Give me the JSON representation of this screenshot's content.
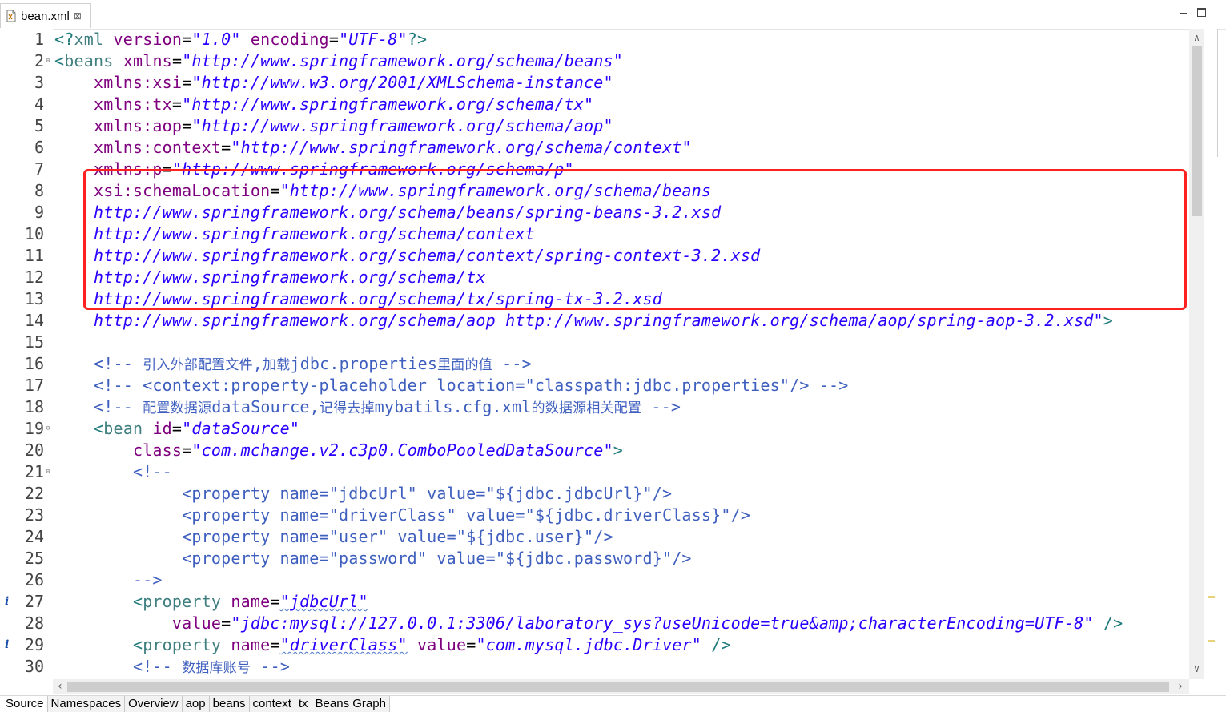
{
  "tab": {
    "label": "bean.xml",
    "close": "⊠"
  },
  "window_controls": {
    "minimize_icon": "minimize-icon",
    "maximize_icon": "maximize-icon"
  },
  "lines": [
    {
      "num": "1",
      "tokens": [
        {
          "c": "tag",
          "t": "<?"
        },
        {
          "c": "el",
          "t": "xml"
        },
        {
          "c": "plain",
          "t": " "
        },
        {
          "c": "attr",
          "t": "version"
        },
        {
          "c": "plain",
          "t": "="
        },
        {
          "c": "val",
          "t": "\"1.0\""
        },
        {
          "c": "plain",
          "t": " "
        },
        {
          "c": "attr",
          "t": "encoding"
        },
        {
          "c": "plain",
          "t": "="
        },
        {
          "c": "val",
          "t": "\"UTF-8\""
        },
        {
          "c": "tag",
          "t": "?>"
        }
      ]
    },
    {
      "num": "2",
      "fold": "⊖",
      "tokens": [
        {
          "c": "tag",
          "t": "<"
        },
        {
          "c": "el",
          "t": "beans"
        },
        {
          "c": "plain",
          "t": " "
        },
        {
          "c": "attr",
          "t": "xmlns"
        },
        {
          "c": "plain",
          "t": "="
        },
        {
          "c": "val",
          "t": "\"http://www.springframework.org/schema/beans\""
        }
      ]
    },
    {
      "num": "3",
      "tokens": [
        {
          "c": "plain",
          "t": "    "
        },
        {
          "c": "attr",
          "t": "xmlns:xsi"
        },
        {
          "c": "plain",
          "t": "="
        },
        {
          "c": "val",
          "t": "\"http://www.w3.org/2001/XMLSchema-instance\""
        }
      ]
    },
    {
      "num": "4",
      "tokens": [
        {
          "c": "plain",
          "t": "    "
        },
        {
          "c": "attr",
          "t": "xmlns:tx"
        },
        {
          "c": "plain",
          "t": "="
        },
        {
          "c": "val",
          "t": "\"http://www.springframework.org/schema/tx\""
        }
      ]
    },
    {
      "num": "5",
      "tokens": [
        {
          "c": "plain",
          "t": "    "
        },
        {
          "c": "attr",
          "t": "xmlns:aop"
        },
        {
          "c": "plain",
          "t": "="
        },
        {
          "c": "val",
          "t": "\"http://www.springframework.org/schema/aop\""
        }
      ]
    },
    {
      "num": "6",
      "tokens": [
        {
          "c": "plain",
          "t": "    "
        },
        {
          "c": "attr",
          "t": "xmlns:context"
        },
        {
          "c": "plain",
          "t": "="
        },
        {
          "c": "val",
          "t": "\"http://www.springframework.org/schema/context\""
        }
      ]
    },
    {
      "num": "7",
      "tokens": [
        {
          "c": "plain",
          "t": "    "
        },
        {
          "c": "attr",
          "t": "xmlns:p"
        },
        {
          "c": "plain",
          "t": "="
        },
        {
          "c": "val",
          "t": "\"http://www.springframework.org/schema/p\""
        }
      ]
    },
    {
      "num": "8",
      "tokens": [
        {
          "c": "plain",
          "t": "    "
        },
        {
          "c": "attr",
          "t": "xsi:schemaLocation"
        },
        {
          "c": "plain",
          "t": "="
        },
        {
          "c": "val",
          "t": "\"http://www.springframework.org/schema/beans"
        }
      ]
    },
    {
      "num": "9",
      "tokens": [
        {
          "c": "plain",
          "t": "    "
        },
        {
          "c": "val",
          "t": "http://www.springframework.org/schema/beans/spring-beans-3.2.xsd"
        }
      ]
    },
    {
      "num": "10",
      "tokens": [
        {
          "c": "plain",
          "t": "    "
        },
        {
          "c": "val",
          "t": "http://www.springframework.org/schema/context"
        }
      ]
    },
    {
      "num": "11",
      "tokens": [
        {
          "c": "plain",
          "t": "    "
        },
        {
          "c": "val",
          "t": "http://www.springframework.org/schema/context/spring-context-3.2.xsd"
        }
      ]
    },
    {
      "num": "12",
      "tokens": [
        {
          "c": "plain",
          "t": "    "
        },
        {
          "c": "val",
          "t": "http://www.springframework.org/schema/tx"
        }
      ]
    },
    {
      "num": "13",
      "tokens": [
        {
          "c": "plain",
          "t": "    "
        },
        {
          "c": "val",
          "t": "http://www.springframework.org/schema/tx/spring-tx-3.2.xsd"
        }
      ]
    },
    {
      "num": "14",
      "tokens": [
        {
          "c": "plain",
          "t": "    "
        },
        {
          "c": "val",
          "t": "http://www.springframework.org/schema/aop http://www.springframework.org/schema/aop/spring-aop-3.2.xsd\""
        },
        {
          "c": "tag",
          "t": ">"
        }
      ]
    },
    {
      "num": "15",
      "tokens": []
    },
    {
      "num": "16",
      "tokens": [
        {
          "c": "plain",
          "t": "    "
        },
        {
          "c": "comment",
          "t": "<!-- "
        },
        {
          "c": "comment-cjk",
          "t": "引入外部配置文件"
        },
        {
          "c": "comment",
          "t": ","
        },
        {
          "c": "comment-cjk",
          "t": "加载"
        },
        {
          "c": "comment",
          "t": "jdbc.properties"
        },
        {
          "c": "comment-cjk",
          "t": "里面的值"
        },
        {
          "c": "comment",
          "t": " -->"
        }
      ]
    },
    {
      "num": "17",
      "tokens": [
        {
          "c": "plain",
          "t": "    "
        },
        {
          "c": "comment",
          "t": "<!-- <context:property-placeholder location=\"classpath:jdbc.properties\"/> -->"
        }
      ]
    },
    {
      "num": "18",
      "tokens": [
        {
          "c": "plain",
          "t": "    "
        },
        {
          "c": "comment",
          "t": "<!-- "
        },
        {
          "c": "comment-cjk",
          "t": "配置数据源"
        },
        {
          "c": "comment",
          "t": "dataSource,"
        },
        {
          "c": "comment-cjk",
          "t": "记得去掉"
        },
        {
          "c": "comment",
          "t": "mybatils.cfg.xml"
        },
        {
          "c": "comment-cjk",
          "t": "的数据源相关配置"
        },
        {
          "c": "comment",
          "t": " -->"
        }
      ]
    },
    {
      "num": "19",
      "fold": "⊖",
      "tokens": [
        {
          "c": "plain",
          "t": "    "
        },
        {
          "c": "tag",
          "t": "<"
        },
        {
          "c": "el",
          "t": "bean"
        },
        {
          "c": "plain",
          "t": " "
        },
        {
          "c": "attr",
          "t": "id"
        },
        {
          "c": "plain",
          "t": "="
        },
        {
          "c": "val",
          "t": "\"dataSource\""
        }
      ]
    },
    {
      "num": "20",
      "tokens": [
        {
          "c": "plain",
          "t": "        "
        },
        {
          "c": "attr",
          "t": "class"
        },
        {
          "c": "plain",
          "t": "="
        },
        {
          "c": "val",
          "t": "\"com.mchange.v2.c3p0.ComboPooledDataSource\""
        },
        {
          "c": "tag",
          "t": ">"
        }
      ]
    },
    {
      "num": "21",
      "fold": "⊖",
      "tokens": [
        {
          "c": "plain",
          "t": "        "
        },
        {
          "c": "comment",
          "t": "<!--"
        }
      ]
    },
    {
      "num": "22",
      "tokens": [
        {
          "c": "plain",
          "t": "             "
        },
        {
          "c": "comment",
          "t": "<property name=\"jdbcUrl\" value=\"${jdbc.jdbcUrl}\"/>"
        }
      ]
    },
    {
      "num": "23",
      "tokens": [
        {
          "c": "plain",
          "t": "             "
        },
        {
          "c": "comment",
          "t": "<property name=\"driverClass\" value=\"${jdbc.driverClass}\"/>"
        }
      ]
    },
    {
      "num": "24",
      "tokens": [
        {
          "c": "plain",
          "t": "             "
        },
        {
          "c": "comment",
          "t": "<property name=\"user\" value=\"${jdbc.user}\"/>"
        }
      ]
    },
    {
      "num": "25",
      "tokens": [
        {
          "c": "plain",
          "t": "             "
        },
        {
          "c": "comment",
          "t": "<property name=\"password\" value=\"${jdbc.password}\"/>"
        }
      ]
    },
    {
      "num": "26",
      "tokens": [
        {
          "c": "plain",
          "t": "        "
        },
        {
          "c": "comment",
          "t": "-->"
        }
      ]
    },
    {
      "num": "27",
      "info": "i",
      "tokens": [
        {
          "c": "plain",
          "t": "        "
        },
        {
          "c": "tag",
          "t": "<"
        },
        {
          "c": "el",
          "t": "property"
        },
        {
          "c": "plain",
          "t": " "
        },
        {
          "c": "attr",
          "t": "name"
        },
        {
          "c": "plain",
          "t": "="
        },
        {
          "c": "val-sq",
          "t": "\"jdbcUrl\""
        }
      ]
    },
    {
      "num": "28",
      "tokens": [
        {
          "c": "plain",
          "t": "            "
        },
        {
          "c": "attr",
          "t": "value"
        },
        {
          "c": "plain",
          "t": "="
        },
        {
          "c": "val",
          "t": "\"jdbc:mysql://127.0.0.1:3306/laboratory_sys?useUnicode=true&amp;characterEncoding=UTF-8\""
        },
        {
          "c": "plain",
          "t": " "
        },
        {
          "c": "tag",
          "t": "/>"
        }
      ]
    },
    {
      "num": "29",
      "info": "i",
      "tokens": [
        {
          "c": "plain",
          "t": "        "
        },
        {
          "c": "tag",
          "t": "<"
        },
        {
          "c": "el",
          "t": "property"
        },
        {
          "c": "plain",
          "t": " "
        },
        {
          "c": "attr",
          "t": "name"
        },
        {
          "c": "plain",
          "t": "="
        },
        {
          "c": "val-sq",
          "t": "\"driverClass\""
        },
        {
          "c": "plain",
          "t": " "
        },
        {
          "c": "attr",
          "t": "value"
        },
        {
          "c": "plain",
          "t": "="
        },
        {
          "c": "val",
          "t": "\"com.mysql.jdbc.Driver\""
        },
        {
          "c": "plain",
          "t": " "
        },
        {
          "c": "tag",
          "t": "/>"
        }
      ]
    },
    {
      "num": "30",
      "tokens": [
        {
          "c": "plain",
          "t": "        "
        },
        {
          "c": "comment",
          "t": "<!-- "
        },
        {
          "c": "comment-cjk",
          "t": "数据库账号"
        },
        {
          "c": "comment",
          "t": " -->"
        }
      ]
    }
  ],
  "bottom_tabs": [
    "Source",
    "Namespaces",
    "Overview",
    "aop",
    "beans",
    "context",
    "tx",
    "Beans Graph"
  ],
  "colors": {
    "highlight_box": "#ff2020",
    "tag": "#1f7a7a",
    "attr": "#7f007f",
    "value": "#2a00ff",
    "comment": "#3f5fbf"
  }
}
